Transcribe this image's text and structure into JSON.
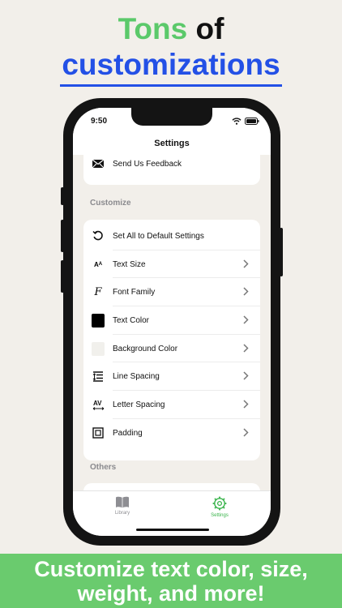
{
  "headline": {
    "word1": "Tons",
    "word2": "of",
    "line2": "customizations"
  },
  "status": {
    "time": "9:50"
  },
  "nav": {
    "title": "Settings"
  },
  "top_card": {
    "feedback_label": "Send Us Feedback"
  },
  "sections": {
    "customize": "Customize",
    "others": "Others"
  },
  "customize_items": [
    {
      "label": "Set All to Default Settings",
      "icon": "reset-icon"
    },
    {
      "label": "Text Size",
      "icon": "text-size-icon"
    },
    {
      "label": "Font Family",
      "icon": "font-family-icon"
    },
    {
      "label": "Text Color",
      "icon": "color-swatch-black",
      "color": "#000000"
    },
    {
      "label": "Background Color",
      "icon": "color-swatch-light",
      "color": "#f1f0ec"
    },
    {
      "label": "Line Spacing",
      "icon": "line-spacing-icon"
    },
    {
      "label": "Letter Spacing",
      "icon": "letter-spacing-icon"
    },
    {
      "label": "Padding",
      "icon": "padding-icon"
    }
  ],
  "tabs": {
    "library": "Library",
    "settings": "Settings"
  },
  "banner": {
    "line1": "Customize text color, size,",
    "line2": "weight, and more!"
  },
  "colors": {
    "accent_green": "#5bc96a",
    "headline_blue": "#2350e6",
    "banner_green": "#6acb6e",
    "tab_active": "#38b34a"
  }
}
